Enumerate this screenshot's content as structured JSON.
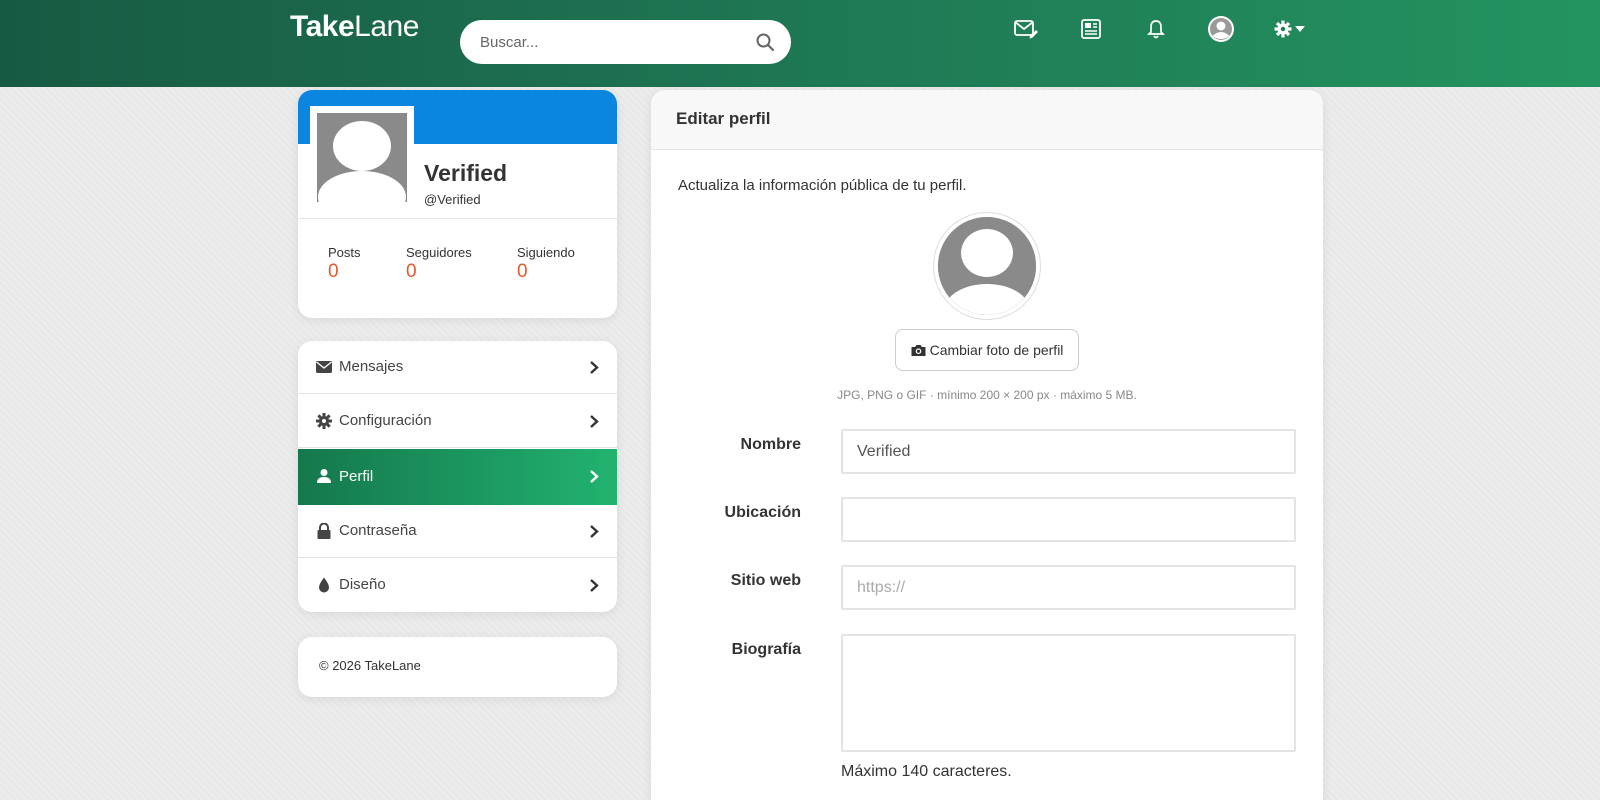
{
  "header": {
    "brand_bold": "Take",
    "brand_light": "Lane",
    "search_placeholder": "Buscar...",
    "icons": [
      "mail-compose-icon",
      "news-icon",
      "bell-icon",
      "user-avatar-icon",
      "gear-dropdown-icon"
    ]
  },
  "profile": {
    "name": "Verified",
    "handle": "@Verified",
    "stats": [
      {
        "label": "Posts",
        "value": "0"
      },
      {
        "label": "Seguidores",
        "value": "0"
      },
      {
        "label": "Siguiendo",
        "value": "0"
      }
    ]
  },
  "menu": {
    "items": [
      {
        "label": "Mensajes",
        "icon": "envelope-icon",
        "active": false
      },
      {
        "label": "Configuración",
        "icon": "gear-icon",
        "active": false
      },
      {
        "label": "Perfil",
        "icon": "user-icon",
        "active": true
      },
      {
        "label": "Contraseña",
        "icon": "lock-icon",
        "active": false
      },
      {
        "label": "Diseño",
        "icon": "droplet-icon",
        "active": false
      }
    ]
  },
  "footer": {
    "copyright": "© 2026 TakeLane"
  },
  "edit": {
    "title": "Editar perfil",
    "intro": "Actualiza la información pública de tu perfil.",
    "photo_button": "Cambiar foto de perfil",
    "photo_hint": "JPG, PNG o GIF · mínimo 200 × 200 px · máximo 5 MB.",
    "fields": {
      "name_label": "Nombre",
      "name_value": "Verified",
      "location_label": "Ubicación",
      "location_value": "",
      "website_label": "Sitio web",
      "website_placeholder": "https://",
      "bio_label": "Biografía",
      "bio_value": ""
    },
    "bio_note": "Máximo 140 caracteres."
  },
  "colors": {
    "header_green": "#1f7a55",
    "cover_blue": "#0a86e0",
    "stat_orange": "#e35a2c",
    "active_green": "#1b9760"
  }
}
